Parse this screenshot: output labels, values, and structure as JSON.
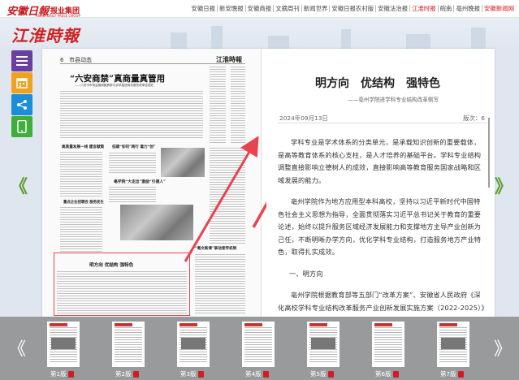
{
  "brand": {
    "logo_cn": "安徽日報",
    "logo_group": "报业集团",
    "logo_en": "ANHUI DAILY PRESS GROUP",
    "masthead": "江淮時報"
  },
  "topnav": [
    {
      "label": "安徽日报",
      "state": ""
    },
    {
      "label": "新安晚报",
      "state": ""
    },
    {
      "label": "安徽商报",
      "state": ""
    },
    {
      "label": "文摘周刊",
      "state": ""
    },
    {
      "label": "新闻世界",
      "state": ""
    },
    {
      "label": "安徽日报农村版",
      "state": ""
    },
    {
      "label": "安徽法治报",
      "state": ""
    },
    {
      "label": "江淮时报",
      "state": "active"
    },
    {
      "label": "皖南",
      "state": ""
    },
    {
      "label": "亳州晚报",
      "state": ""
    },
    {
      "label": "安徽新闻网",
      "state": "hl"
    }
  ],
  "tools": [
    {
      "name": "menu-icon",
      "color": "#6b3fa0"
    },
    {
      "name": "calendar-icon",
      "color": "#f0a21e"
    },
    {
      "name": "share-icon",
      "color": "#1a8fd8"
    },
    {
      "name": "mobile-icon",
      "color": "#3fae3a"
    }
  ],
  "nav": {
    "prev": "《",
    "next": "》",
    "strip_prev": "《",
    "strip_next": "》"
  },
  "newspaper_page": {
    "page_no": "6",
    "section": "市县动态",
    "name": "江淮時報",
    "headline": "“六安商禁”真商量真管用",
    "subhead": "——六安市市场监管局聚焦群众诉求推进商务服务改革显成效",
    "small_heads": [
      "高质量发展一线 建言献策",
      "低碳“如何”践行 着力“创”",
      "重点企业招聘会 服务民生",
      "亳学院“大走出”激励“引德人”",
      "“亳文新课”联动宣传机制",
      "明方向 优结构 强特色"
    ]
  },
  "article": {
    "title": "明方向　优结构　强特色",
    "subtitle": "——亳州学院进学科专业结构改革侧写",
    "date": "2024年09月13日",
    "edition": "版次：6",
    "paragraphs": [
      "学科专业是学术体系的分类单元，是承载知识创新的重要载体，是高等教育体系的核心支柱，是人才培养的基础平台。学科专业结构调整直接影响立德树人的成效，直接影响高等教育服务国家战略和区域发展的能力。",
      "亳州学院作为地方应用型本科高校，坚持以习近平新时代中国特色社会主义思想为指导，全面贯彻落实习近平总书记关于教育的重要论述，始终以提升服务区域经济发展能力和支撑地方主导产业创新为己任，不断明晰办学方向，优化学科专业结构，打造服务地方产业特色，取得扎实成效。",
      "一、明方向",
      "亳州学院根据教育部等五部门“改革方案”、安徽省人民政府《深化高校学科专业结构改革服务产业创新发展实施方案（2022-2025）》文件精神和《安徽省地方应用型高水平本科院校建设标准》，锚定“三地一区”战略定位和亳州市“六一”战"
    ]
  },
  "thumbnails": [
    {
      "label": "第1版"
    },
    {
      "label": "第2版"
    },
    {
      "label": "第3版"
    },
    {
      "label": "第4版"
    },
    {
      "label": "第5版"
    },
    {
      "label": "第6版"
    },
    {
      "label": "第7版"
    }
  ],
  "colors": {
    "accent_red": "#d21c24",
    "nav_green": "#5b9e2b",
    "strip_gray": "#999a9b"
  }
}
